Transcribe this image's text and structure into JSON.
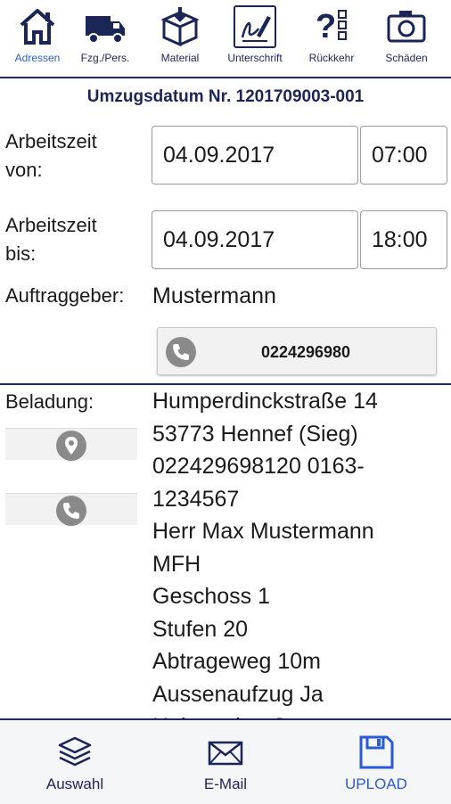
{
  "nav": {
    "tabs": [
      {
        "label": "Adressen",
        "icon": "house-icon"
      },
      {
        "label": "Fzg./Pers.",
        "icon": "truck-icon"
      },
      {
        "label": "Material",
        "icon": "box-icon"
      },
      {
        "label": "Unterschrift",
        "icon": "signature-icon"
      },
      {
        "label": "Rückkehr",
        "icon": "questionnaire-icon"
      },
      {
        "label": "Schäden",
        "icon": "camera-icon"
      }
    ],
    "active_color": "#2a5bd7",
    "primary_color": "#1b2556"
  },
  "header": {
    "title": "Umzugsdatum Nr. 1201709003-001"
  },
  "worktime_from": {
    "label_line1": "Arbeitszeit",
    "label_line2": "von:",
    "date": "04.09.2017",
    "time": "07:00"
  },
  "worktime_to": {
    "label_line1": "Arbeitszeit",
    "label_line2": "bis:",
    "date": "04.09.2017",
    "time": "18:00"
  },
  "client": {
    "label": "Auftraggeber:",
    "name": "Mustermann",
    "phone": "0224296980"
  },
  "loading": {
    "label": "Beladung:",
    "lines": [
      "Humperdinckstraße 14",
      "53773 Hennef (Sieg)",
      "022429698120 0163-",
      "1234567",
      "Herr Max Mustermann",
      "MFH",
      "Geschoss 1",
      "Stufen 20",
      "Abtrageweg 10m",
      "Aussenaufzug Ja",
      "Halteverbot Ja"
    ]
  },
  "bottom": {
    "tabs": [
      {
        "label": "Auswahl",
        "icon": "layers-icon"
      },
      {
        "label": "E-Mail",
        "icon": "envelope-icon"
      },
      {
        "label": "UPLOAD",
        "icon": "floppy-disk-icon"
      }
    ]
  }
}
